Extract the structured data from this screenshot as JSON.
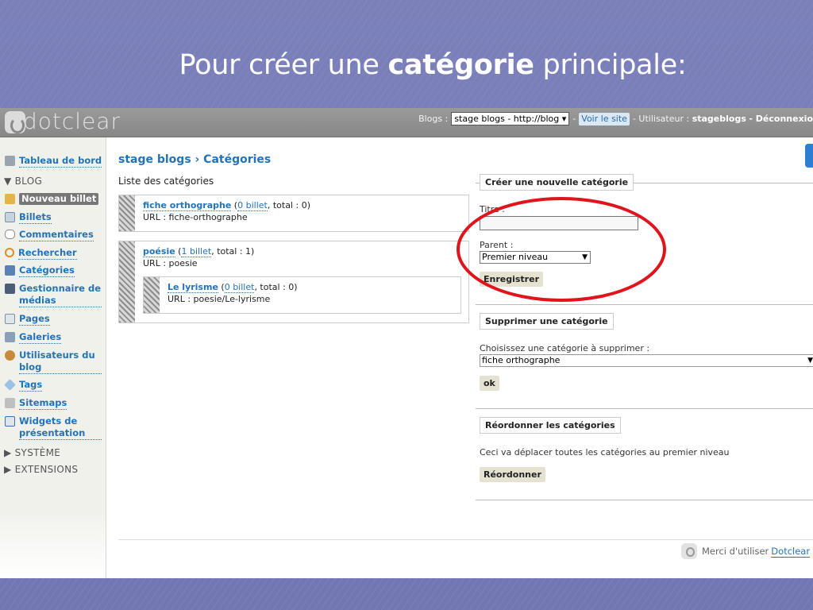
{
  "slide": {
    "title_prefix": "Pour créer une ",
    "title_bold": "catégorie",
    "title_suffix": " principale:"
  },
  "topbar": {
    "logo": "dotclear",
    "blogs_label": "Blogs :",
    "blog_select": "stage blogs - http://blog",
    "sep1": "-",
    "view_site": "Voir le site",
    "user_label": "- Utilisateur :",
    "user_name": "stageblogs",
    "logout": "- Déconnexio"
  },
  "sidebar": {
    "dashboard": "Tableau de bord",
    "blog_head": "▼ BLOG",
    "items": [
      {
        "label": "Nouveau billet",
        "icon": "pencil-icon"
      },
      {
        "label": "Billets",
        "icon": "document-icon"
      },
      {
        "label": "Commentaires",
        "icon": "comment-icon"
      },
      {
        "label": "Rechercher",
        "icon": "search-icon"
      },
      {
        "label": "Catégories",
        "icon": "folder-icon"
      },
      {
        "label": "Gestionnaire de médias",
        "icon": "media-icon"
      },
      {
        "label": "Pages",
        "icon": "page-icon"
      },
      {
        "label": "Galeries",
        "icon": "gallery-icon"
      },
      {
        "label": "Utilisateurs du blog",
        "icon": "users-icon"
      },
      {
        "label": "Tags",
        "icon": "tag-icon"
      },
      {
        "label": "Sitemaps",
        "icon": "sitemap-icon"
      },
      {
        "label": "Widgets de présentation",
        "icon": "widget-icon"
      }
    ],
    "system_head": "▶ SYSTÈME",
    "extensions_head": "▶ EXTENSIONS"
  },
  "main": {
    "breadcrumb": "stage blogs › Catégories",
    "list_title": "Liste des catégories",
    "categories": [
      {
        "name": "fiche orthographe",
        "open": " (",
        "count": "0 billet",
        "total": ", total : 0)",
        "url": "URL : fiche-orthographe"
      },
      {
        "name": "poésie",
        "open": " (",
        "count": "1 billet",
        "total": ", total : 1)",
        "url": "URL : poesie"
      },
      {
        "name": "Le lyrisme",
        "open": " (",
        "count": "0 billet",
        "total": ", total : 0)",
        "url": "URL : poesie/Le-lyrisme"
      }
    ],
    "create": {
      "legend": "Créer une nouvelle catégorie",
      "title_label": "Titre :",
      "title_value": "",
      "parent_label": "Parent :",
      "parent_value": "Premier niveau",
      "save": "Enregistrer"
    },
    "delete": {
      "legend": "Supprimer une catégorie",
      "choose_label": "Choisissez une catégorie à supprimer :",
      "choose_value": "fiche orthographe",
      "ok": "ok"
    },
    "reorder": {
      "legend": "Réordonner les catégories",
      "note": "Ceci va déplacer toutes les catégories au premier niveau",
      "button": "Réordonner"
    }
  },
  "footer": {
    "text": "Merci d'utiliser",
    "link": "Dotclear"
  },
  "colors": {
    "slide_bg": "#7579b4",
    "link": "#2373b6",
    "highlight": "#e0141c"
  }
}
